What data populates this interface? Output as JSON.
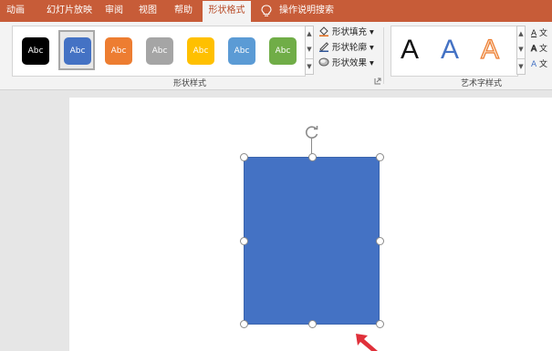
{
  "tabs": [
    {
      "label": "动画"
    },
    {
      "label": "幻灯片放映"
    },
    {
      "label": "审阅"
    },
    {
      "label": "视图"
    },
    {
      "label": "帮助"
    },
    {
      "label": "形状格式"
    }
  ],
  "tell_me": "操作说明搜索",
  "shape_styles": {
    "swatch_text": "Abc",
    "swatch_colors": [
      "#000000",
      "#4472c4",
      "#ed7d31",
      "#a5a5a5",
      "#ffc000",
      "#5b9bd5",
      "#70ad47"
    ],
    "fill_label": "形状填充",
    "outline_label": "形状轮廓",
    "effects_label": "形状效果",
    "group_label": "形状样式"
  },
  "wordart_styles": {
    "glyph": "A",
    "group_label": "艺术字样式",
    "side_glyph": "A",
    "side_text": "文"
  },
  "shape": {
    "fill_color": "#4472c4"
  },
  "colors": {
    "tab_bar": "#c75c38",
    "pointer_arrow": "#e0303a"
  }
}
